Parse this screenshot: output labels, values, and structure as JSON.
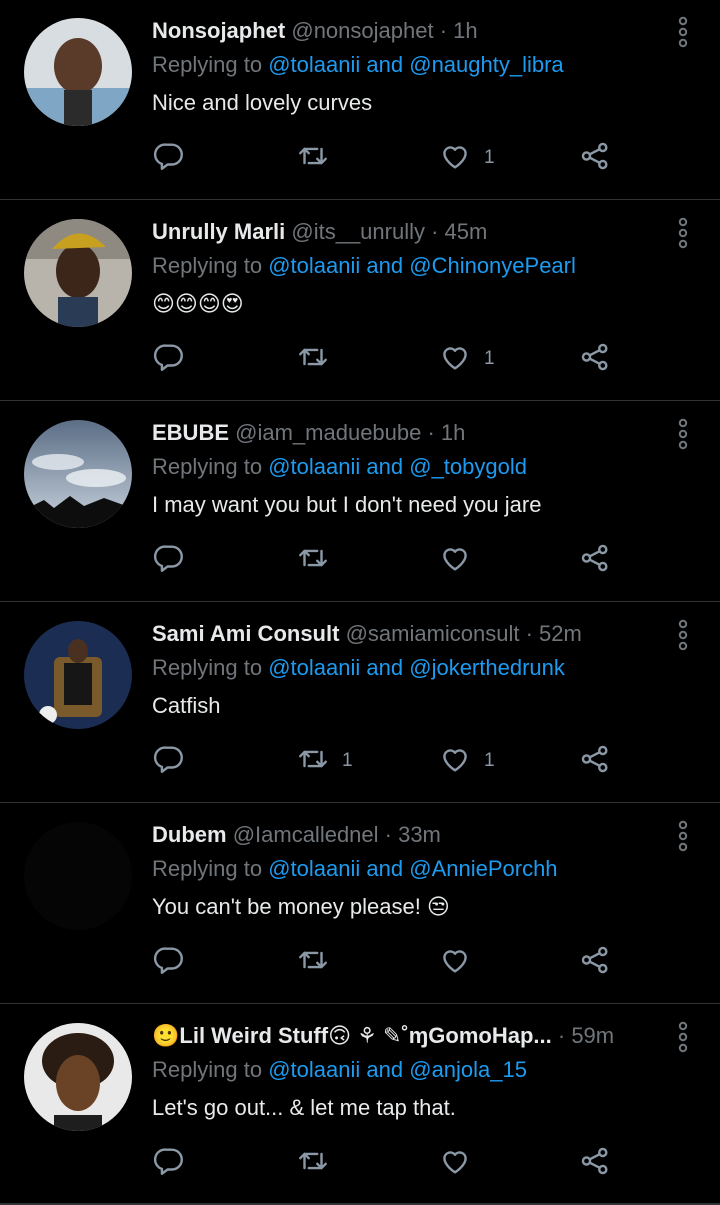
{
  "theme": {
    "background": "#000000",
    "accent": "#1d9bf0",
    "muted": "#71767b",
    "text": "#e7e9ea",
    "divider": "#2f3336"
  },
  "icons": {
    "reply": "reply-bubble-icon",
    "retweet": "retweet-icon",
    "like": "heart-icon",
    "share": "share-icon",
    "more": "vertical-dots-icon"
  },
  "tweets": [
    {
      "name": "Nonsojaphet",
      "handle": "@nonsojaphet · 1h",
      "reply_prefix": "Replying to",
      "mention1": "@tolaanii",
      "and": "and",
      "mention2": "@naughty_libra",
      "text": "Nice and lovely curves",
      "retweets": "",
      "likes": "1"
    },
    {
      "name": "Unrully Marli",
      "handle": "@its__unrully · 45m",
      "reply_prefix": "Replying to",
      "mention1": "@tolaanii",
      "and": "and",
      "mention2": "@ChinonyePearl",
      "text": "😊😊😊😍",
      "retweets": "",
      "likes": "1"
    },
    {
      "name": "EBUBE",
      "handle": "@iam_maduebube · 1h",
      "reply_prefix": "Replying to",
      "mention1": "@tolaanii",
      "and": "and",
      "mention2": "@_tobygold",
      "text": "I may want you but I don't need you jare",
      "retweets": "",
      "likes": ""
    },
    {
      "name": "Sami Ami Consult",
      "handle": "@samiamiconsult · 52m",
      "reply_prefix": "Replying to",
      "mention1": "@tolaanii",
      "and": "and",
      "mention2": "@jokerthedrunk",
      "text": "Catfish",
      "retweets": "1",
      "likes": "1"
    },
    {
      "name": "Dubem",
      "handle": "@Iamcallednel · 33m",
      "reply_prefix": "Replying to",
      "mention1": "@tolaanii",
      "and": "and",
      "mention2": "@AnniePorchh",
      "text": "You can't be money please! 😒",
      "retweets": "",
      "likes": ""
    },
    {
      "name": "🙂Lil Weird Stuff🙃 ⚘ ✎˚ɱGomoHap...",
      "handle": "· 59m",
      "reply_prefix": "Replying to",
      "mention1": "@tolaanii",
      "and": "and",
      "mention2": "@anjola_15",
      "text": "Let's go out... & let me tap that.",
      "retweets": "",
      "likes": ""
    }
  ]
}
